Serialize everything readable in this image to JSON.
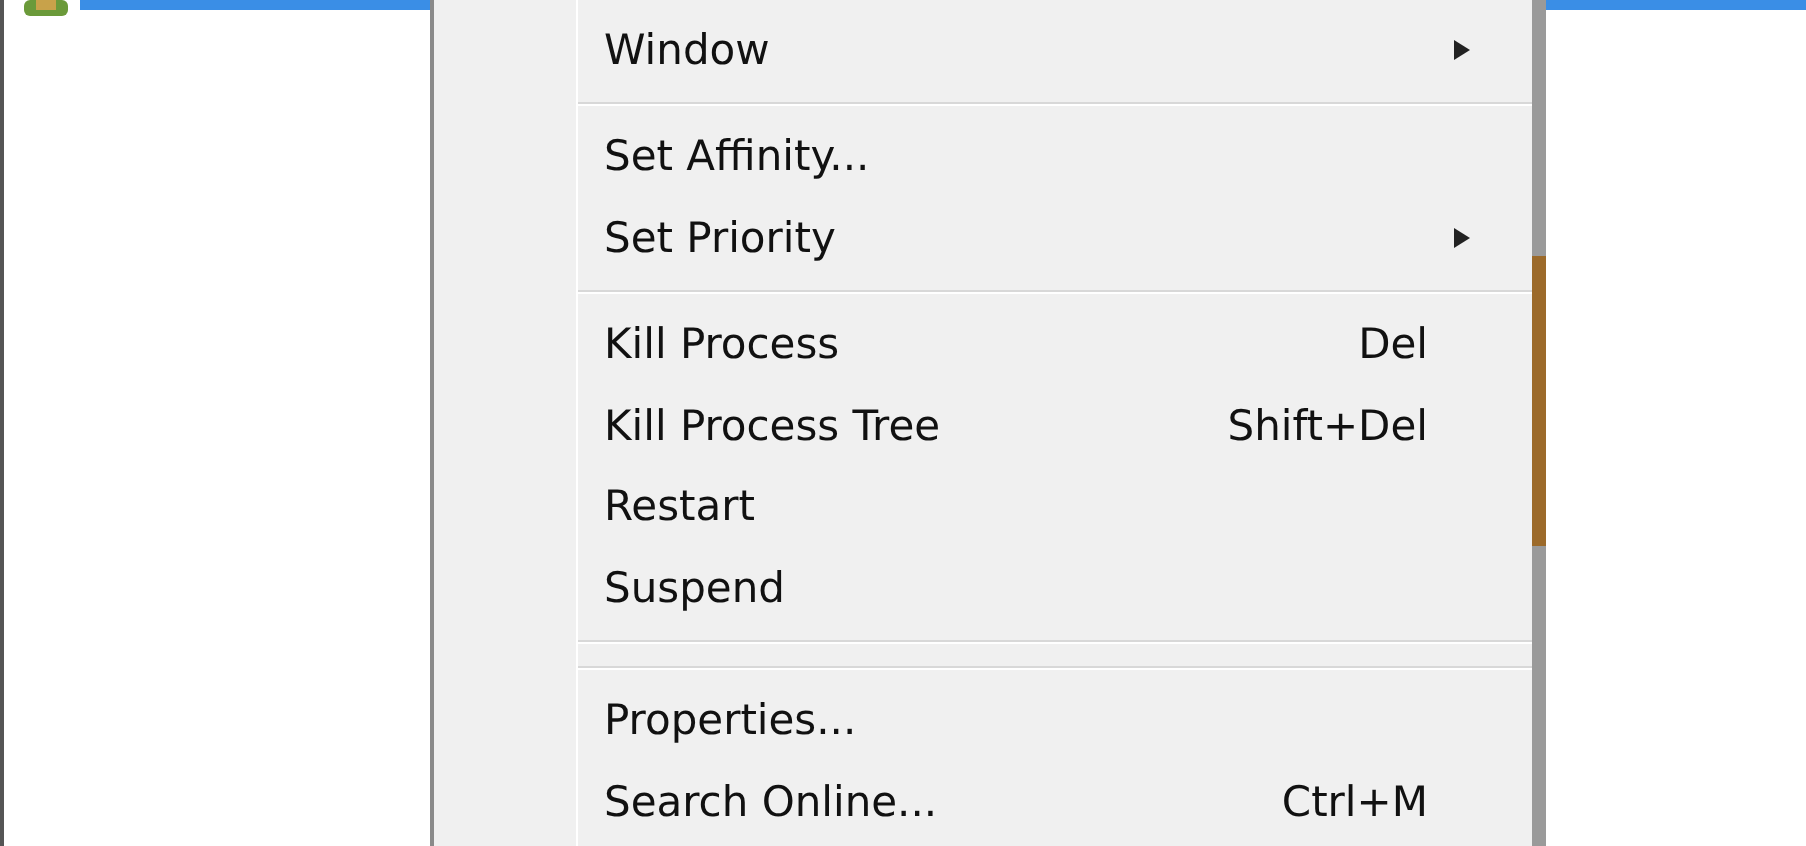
{
  "context_menu": {
    "items": [
      {
        "kind": "item",
        "label": "Window",
        "submenu": true
      },
      {
        "kind": "separator"
      },
      {
        "kind": "item",
        "label": "Set Affinity..."
      },
      {
        "kind": "item",
        "label": "Set Priority",
        "submenu": true
      },
      {
        "kind": "separator"
      },
      {
        "kind": "item",
        "label": "Kill Process",
        "shortcut": "Del"
      },
      {
        "kind": "item",
        "label": "Kill Process Tree",
        "shortcut": "Shift+Del"
      },
      {
        "kind": "item",
        "label": "Restart"
      },
      {
        "kind": "item",
        "label": "Suspend"
      },
      {
        "kind": "separator"
      },
      {
        "kind": "separator"
      },
      {
        "kind": "item",
        "label": "Properties..."
      },
      {
        "kind": "item",
        "label": "Search Online...",
        "shortcut": "Ctrl+M"
      }
    ]
  }
}
